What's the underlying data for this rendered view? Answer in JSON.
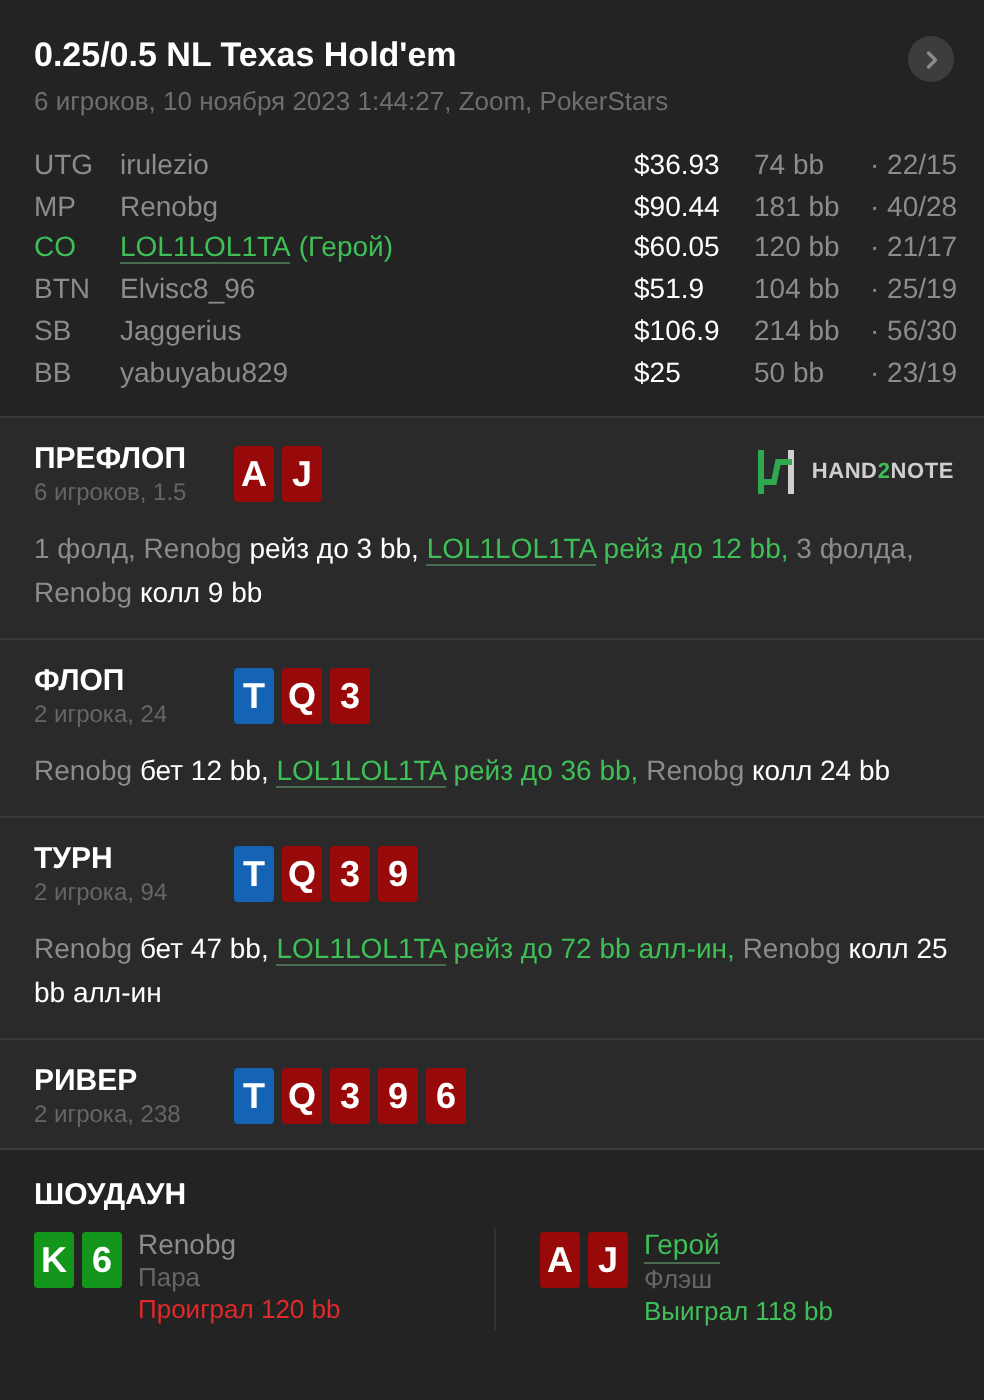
{
  "header": {
    "title": "0.25/0.5 NL Texas Hold'em",
    "subtitle": "6 игроков, 10 ноября 2023 1:44:27, Zoom, PokerStars"
  },
  "players": [
    {
      "position": "UTG",
      "name": "irulezio",
      "hero": false,
      "stack": "$36.93",
      "bb": "74 bb",
      "stats": "· 22/15"
    },
    {
      "position": "MP",
      "name": "Renobg",
      "hero": false,
      "stack": "$90.44",
      "bb": "181 bb",
      "stats": "· 40/28"
    },
    {
      "position": "CO",
      "name": "LOL1LOL1TA",
      "tag": "(Герой)",
      "hero": true,
      "stack": "$60.05",
      "bb": "120 bb",
      "stats": "· 21/17"
    },
    {
      "position": "BTN",
      "name": "Elvisc8_96",
      "hero": false,
      "stack": "$51.9",
      "bb": "104 bb",
      "stats": "· 25/19"
    },
    {
      "position": "SB",
      "name": "Jaggerius",
      "hero": false,
      "stack": "$106.9",
      "bb": "214 bb",
      "stats": "· 56/30"
    },
    {
      "position": "BB",
      "name": "yabuyabu829",
      "hero": false,
      "stack": "$25",
      "bb": "50 bb",
      "stats": "· 23/19"
    }
  ],
  "logo": [
    {
      "text": "HAND",
      "kind": "plain"
    },
    {
      "text": "2",
      "kind": "accent"
    },
    {
      "text": "NOTE",
      "kind": "plain"
    }
  ],
  "streets": [
    {
      "name": "ПРЕФЛОП",
      "info": "6 игроков, 1.5",
      "logo": true,
      "cards": [
        {
          "rank": "A",
          "color": "#980a0a"
        },
        {
          "rank": "J",
          "color": "#980a0a"
        }
      ],
      "actions": [
        {
          "kind": "muted",
          "text": "1 фолд,"
        },
        {
          "kind": "player",
          "text": "Renobg"
        },
        {
          "kind": "action",
          "text": "рейз до 3 bb,"
        },
        {
          "kind": "hero_player",
          "text": "LOL1LOL1TA"
        },
        {
          "kind": "hero_action",
          "text": "рейз до 12 bb,"
        },
        {
          "kind": "muted",
          "text": "3 фолда,"
        },
        {
          "kind": "player",
          "text": "Renobg"
        },
        {
          "kind": "action",
          "text": "колл 9 bb"
        }
      ]
    },
    {
      "name": "ФЛОП",
      "info": "2 игрока, 24",
      "cards": [
        {
          "rank": "T",
          "color": "#1463b4"
        },
        {
          "rank": "Q",
          "color": "#980a0a"
        },
        {
          "rank": "3",
          "color": "#980a0a"
        }
      ],
      "actions": [
        {
          "kind": "player",
          "text": "Renobg"
        },
        {
          "kind": "action",
          "text": "бет 12 bb,"
        },
        {
          "kind": "hero_player",
          "text": "LOL1LOL1TA"
        },
        {
          "kind": "hero_action",
          "text": "рейз до 36 bb,"
        },
        {
          "kind": "player",
          "text": "Renobg"
        },
        {
          "kind": "action",
          "text": "колл 24 bb"
        }
      ]
    },
    {
      "name": "ТУРН",
      "info": "2 игрока, 94",
      "cards": [
        {
          "rank": "T",
          "color": "#1463b4"
        },
        {
          "rank": "Q",
          "color": "#980a0a"
        },
        {
          "rank": "3",
          "color": "#980a0a"
        },
        {
          "rank": "9",
          "color": "#980a0a"
        }
      ],
      "actions": [
        {
          "kind": "player",
          "text": "Renobg"
        },
        {
          "kind": "action",
          "text": "бет 47 bb,"
        },
        {
          "kind": "hero_player",
          "text": "LOL1LOL1TA"
        },
        {
          "kind": "hero_action",
          "text": "рейз до 72 bb алл-ин,"
        },
        {
          "kind": "player",
          "text": "Renobg"
        },
        {
          "kind": "action",
          "text": "колл 25 bb алл-ин"
        }
      ]
    },
    {
      "name": "РИВЕР",
      "info": "2 игрока, 238",
      "cards": [
        {
          "rank": "T",
          "color": "#1463b4"
        },
        {
          "rank": "Q",
          "color": "#980a0a"
        },
        {
          "rank": "3",
          "color": "#980a0a"
        },
        {
          "rank": "9",
          "color": "#980a0a"
        },
        {
          "rank": "6",
          "color": "#980a0a"
        }
      ]
    }
  ],
  "showdown": {
    "title": "ШОУДАУН",
    "hands": [
      {
        "cards": [
          {
            "rank": "K",
            "color": "#13961b"
          },
          {
            "rank": "6",
            "color": "#13961b"
          }
        ],
        "player": "Renobg",
        "hero": false,
        "combo": "Пара",
        "result": "Проиграл 120 bb",
        "won": false
      },
      {
        "cards": [
          {
            "rank": "A",
            "color": "#980a0a"
          },
          {
            "rank": "J",
            "color": "#980a0a"
          }
        ],
        "player": "Герой",
        "hero": true,
        "combo": "Флэш",
        "result": "Выиграл 118 bb",
        "won": true
      }
    ]
  }
}
